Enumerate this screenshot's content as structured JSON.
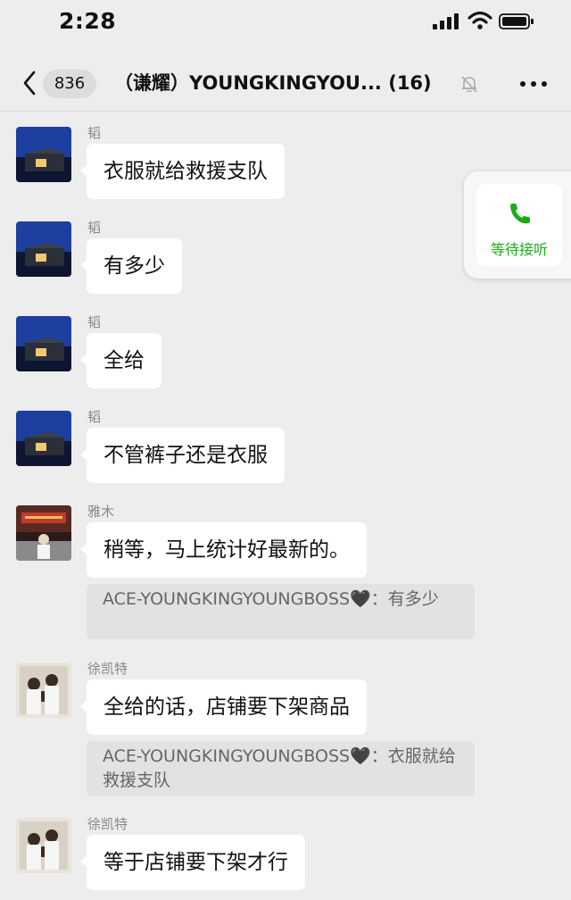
{
  "status_bar": {
    "time": "2:28"
  },
  "nav": {
    "unread_count": "836",
    "title": "（谦耀）YOUNGKINGYOU... (16)"
  },
  "call_widget": {
    "label": "等待接听"
  },
  "colors": {
    "accent_green": "#1aad19",
    "bubble": "#ffffff",
    "background": "#ededed",
    "quote_bg": "#e2e2e2"
  },
  "messages": [
    {
      "sender": "韬",
      "text": "衣服就给救援支队"
    },
    {
      "sender": "韬",
      "text": "有多少"
    },
    {
      "sender": "韬",
      "text": "全给"
    },
    {
      "sender": "韬",
      "text": "不管裤子还是衣服"
    },
    {
      "sender": "雅木",
      "text": "稍等，马上统计好最新的。",
      "quote": "ACE-YOUNGKINGYOUNGBOSS🖤：有多少"
    },
    {
      "sender": "徐凯特",
      "text": "全给的话，店铺要下架商品",
      "quote": "ACE-YOUNGKINGYOUNGBOSS🖤：衣服就给救援支队"
    },
    {
      "sender": "徐凯特",
      "text": "等于店铺要下架才行"
    }
  ]
}
